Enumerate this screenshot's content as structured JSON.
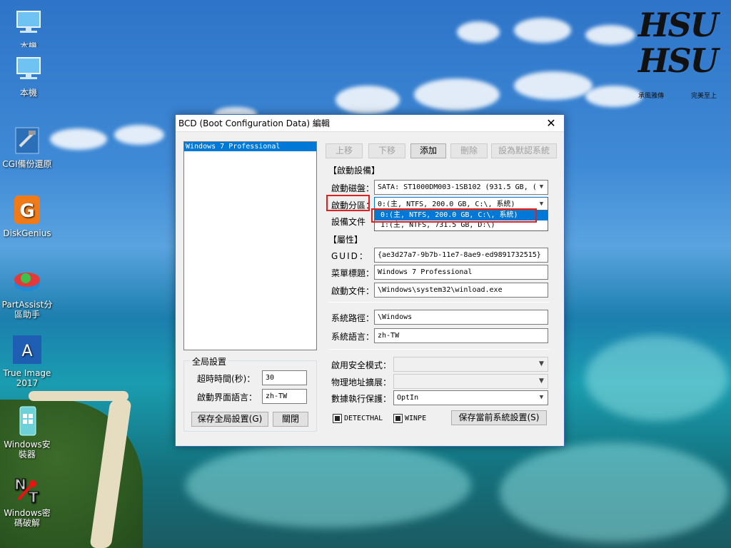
{
  "desktop": {
    "icons": [
      {
        "label": "本機",
        "icon": "computer-icon"
      },
      {
        "label": "本機",
        "icon": "computer-icon"
      },
      {
        "label": "CGI備份還原",
        "icon": "cgi-backup-icon"
      },
      {
        "label": "DiskGenius",
        "icon": "diskgenius-icon"
      },
      {
        "label": "PartAssist分區助手",
        "icon": "partassist-icon"
      },
      {
        "label": "True Image 2017",
        "icon": "true-image-icon"
      },
      {
        "label": "Windows安裝器",
        "icon": "windows-installer-icon"
      },
      {
        "label": "Windows密碼破解",
        "icon": "nt-password-icon"
      }
    ],
    "logo": {
      "text1": "HSU",
      "text2": "HSU",
      "caption_left": "承風雅傳",
      "caption_right": "完美至上"
    }
  },
  "window": {
    "title": "BCD (Boot Configuration Data) 編輯",
    "entries": [
      "Windows 7 Professional"
    ],
    "toolbar": {
      "up": "上移",
      "down": "下移",
      "add": "添加",
      "delete": "刪除",
      "set_default": "設為默認系統"
    },
    "boot_device": {
      "title": "【啟動設備】",
      "disk_label": "啟動磁盤：",
      "disk_value": "SATA: ST1000DM003-1SB102 (931.5 GB, (",
      "partition_label": "啟動分區：",
      "partition_value": "0:(主,  NTFS, 200.0 GB, C:\\, 系統)",
      "device_file_label": "設備文件",
      "partition_options": [
        "0:(主,  NTFS, 200.0 GB, C:\\, 系統)",
        "1:(主,  NTFS, 731.5 GB, D:\\)"
      ]
    },
    "properties": {
      "title": "【屬性】",
      "guid_label": "GUID：",
      "guid_value": "{ae3d27a7-9b7b-11e7-8ae9-ed9891732515}",
      "menu_title_label": "菜單標題：",
      "menu_title_value": "Windows 7 Professional",
      "boot_file_label": "啟動文件：",
      "boot_file_value": "\\Windows\\system32\\winload.exe",
      "system_path_label": "系統路徑：",
      "system_path_value": "\\Windows",
      "system_lang_label": "系統語言：",
      "system_lang_value": "zh-TW"
    },
    "advanced": {
      "safe_mode_label": "啟用安全模式：",
      "safe_mode_value": "",
      "pae_label": "物理地址擴展：",
      "pae_value": "",
      "dep_label": "數據執行保護：",
      "dep_value": "OptIn",
      "detecthal_label": "DETECTHAL",
      "winpe_label": "WINPE",
      "save_current_label": "保存當前系統設置(S)"
    },
    "global": {
      "title": "全局設置",
      "timeout_label": "超時時間(秒)：",
      "timeout_value": "30",
      "ui_lang_label": "啟動界面語言：",
      "ui_lang_value": "zh-TW",
      "save_global_label": "保存全局設置(G)",
      "close_label": "關閉"
    }
  }
}
